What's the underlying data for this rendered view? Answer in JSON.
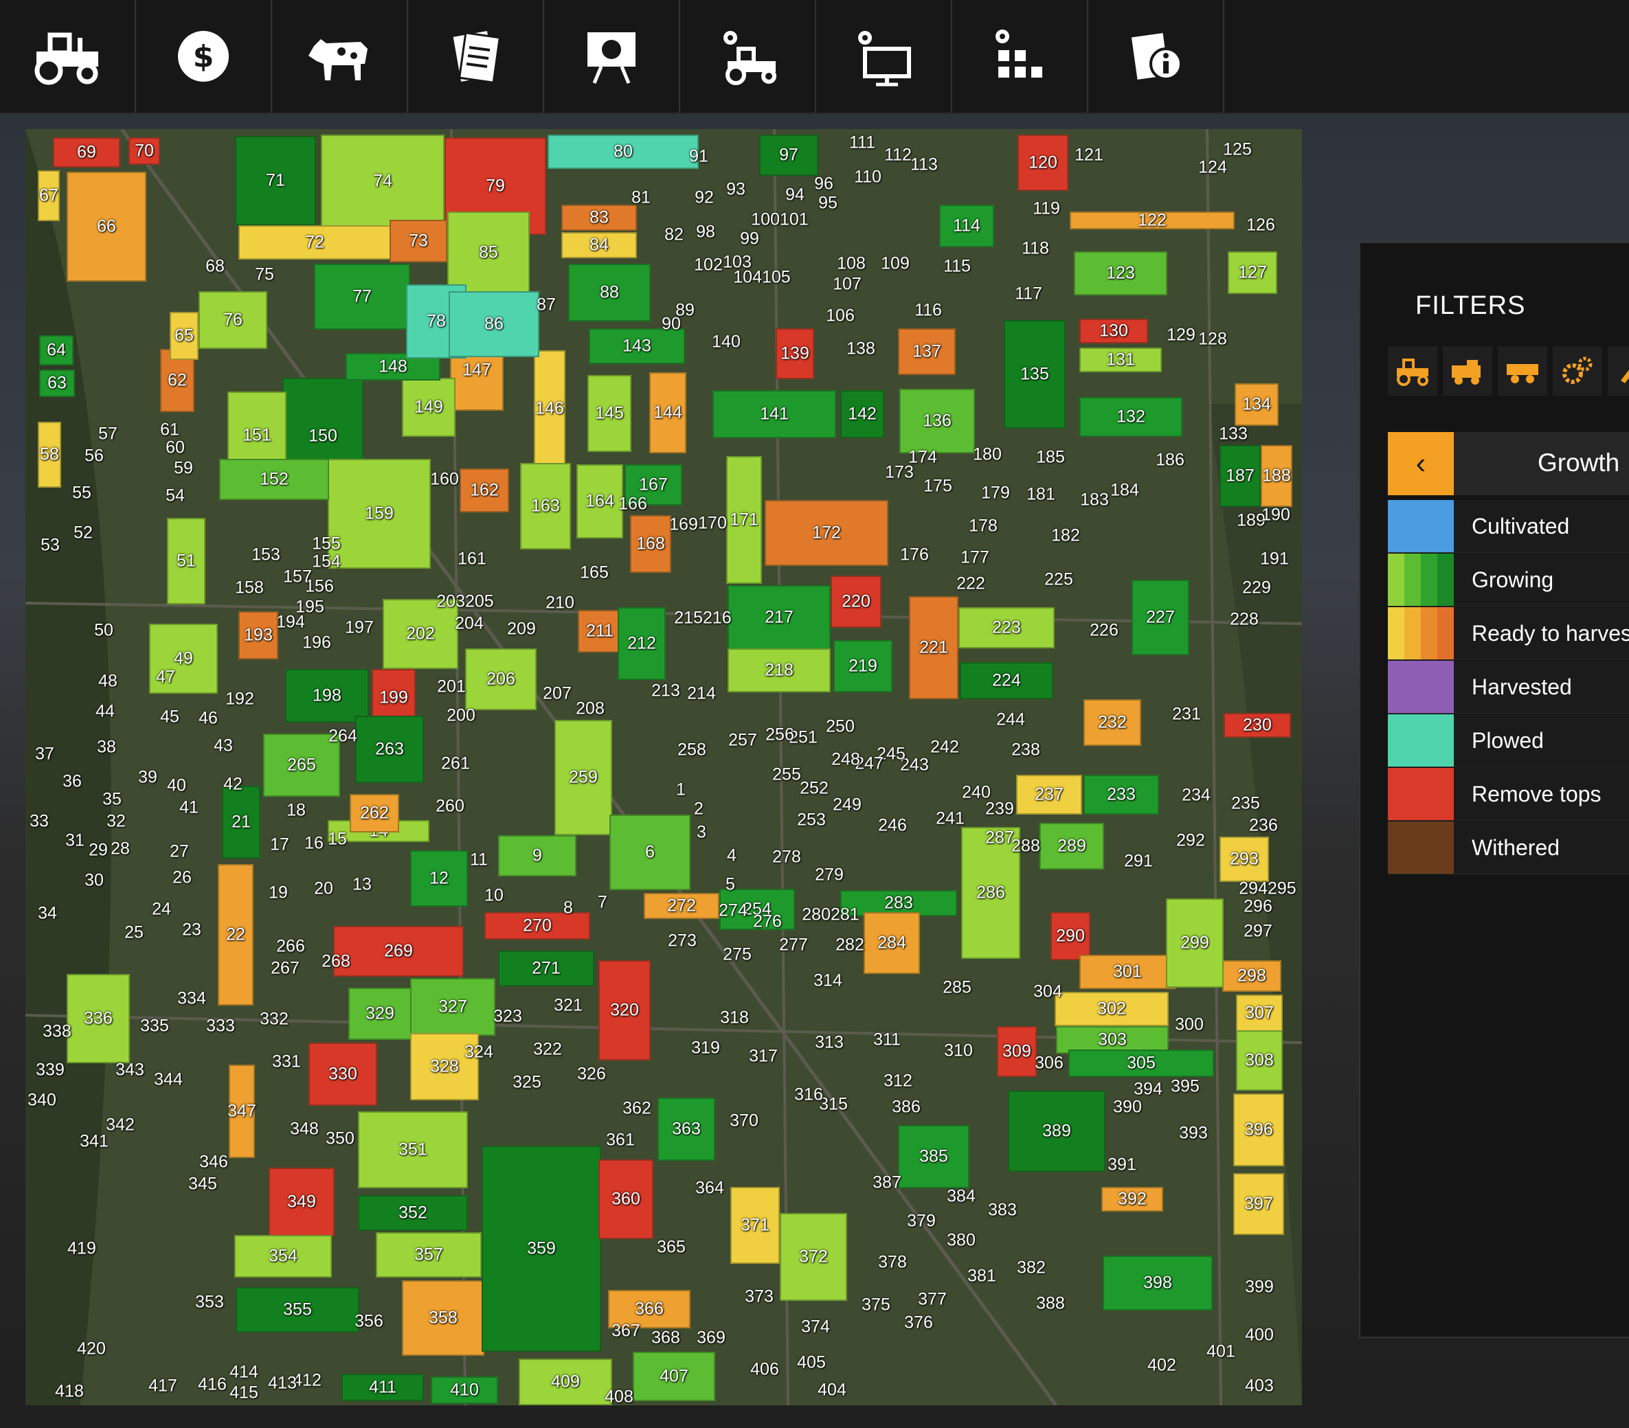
{
  "tabs": [
    {
      "icon": "tractor-icon"
    },
    {
      "icon": "dollar-icon"
    },
    {
      "icon": "cow-icon"
    },
    {
      "icon": "contracts-icon"
    },
    {
      "icon": "tutorial-board-icon"
    },
    {
      "icon": "vehicle-settings-icon"
    },
    {
      "icon": "display-settings-icon"
    },
    {
      "icon": "production-settings-icon"
    },
    {
      "icon": "help-info-icon"
    }
  ],
  "filters": {
    "title": "FILTERS",
    "filter_icons": [
      "tractor-icon",
      "harvester-icon",
      "trailer-icon",
      "gears-icon",
      "tool-icon"
    ],
    "category": "Growth",
    "legend": [
      {
        "label": "Cultivated",
        "colors": [
          "#4a9de0"
        ]
      },
      {
        "label": "Growing",
        "colors": [
          "#8fd23a",
          "#5cbd32",
          "#2fa32d",
          "#1a8a28"
        ]
      },
      {
        "label": "Ready to harves",
        "colors": [
          "#f0d040",
          "#f0b030",
          "#e98a2c",
          "#e0702a"
        ]
      },
      {
        "label": "Harvested",
        "colors": [
          "#8e5fb5"
        ]
      },
      {
        "label": "Plowed",
        "colors": [
          "#4fd4ae"
        ]
      },
      {
        "label": "Remove tops",
        "colors": [
          "#d93a2a"
        ]
      },
      {
        "label": "Withered",
        "colors": [
          "#6a3c1c"
        ]
      }
    ]
  },
  "colors": {
    "plowed": "#4fd4ae",
    "growing_1": "#9bd53a",
    "growing_2": "#5cbd32",
    "growing_3": "#1e9a2c",
    "growing_4": "#13801f",
    "ready_1": "#f0d040",
    "ready_2": "#eea030",
    "ready_3": "#e07a2a",
    "remove_tops": "#d83828"
  },
  "fields": [
    {
      "id": "69",
      "c": "remove_tops"
    },
    {
      "id": "70",
      "c": "remove_tops"
    },
    {
      "id": "66",
      "c": "ready_2"
    },
    {
      "id": "67",
      "c": "ready_1"
    },
    {
      "id": "71",
      "c": "growing_4"
    },
    {
      "id": "74",
      "c": "growing_1"
    },
    {
      "id": "79",
      "c": "remove_tops"
    },
    {
      "id": "80",
      "c": "plowed"
    },
    {
      "id": "72",
      "c": "ready_1"
    },
    {
      "id": "73",
      "c": "ready_3"
    },
    {
      "id": "85",
      "c": "growing_1"
    },
    {
      "id": "77",
      "c": "growing_3"
    },
    {
      "id": "76",
      "c": "growing_1"
    },
    {
      "id": "83",
      "c": "ready_3"
    },
    {
      "id": "84",
      "c": "ready_1"
    },
    {
      "id": "88",
      "c": "growing_3"
    },
    {
      "id": "97",
      "c": "growing_4"
    },
    {
      "id": "120",
      "c": "remove_tops"
    },
    {
      "id": "114",
      "c": "growing_3"
    },
    {
      "id": "122",
      "c": "ready_2"
    },
    {
      "id": "123",
      "c": "growing_2"
    },
    {
      "id": "127",
      "c": "growing_1"
    },
    {
      "id": "135",
      "c": "growing_4"
    },
    {
      "id": "130",
      "c": "remove_tops"
    },
    {
      "id": "131",
      "c": "growing_1"
    },
    {
      "id": "132",
      "c": "growing_3"
    },
    {
      "id": "134",
      "c": "ready_2"
    },
    {
      "id": "147",
      "c": "ready_2"
    },
    {
      "id": "146",
      "c": "ready_1"
    },
    {
      "id": "143",
      "c": "growing_3"
    },
    {
      "id": "144",
      "c": "ready_2"
    },
    {
      "id": "141",
      "c": "growing_3"
    },
    {
      "id": "142",
      "c": "growing_4"
    },
    {
      "id": "137",
      "c": "ready_3"
    },
    {
      "id": "139",
      "c": "remove_tops"
    },
    {
      "id": "150",
      "c": "growing_4"
    },
    {
      "id": "151",
      "c": "growing_1"
    },
    {
      "id": "159",
      "c": "growing_1"
    },
    {
      "id": "152",
      "c": "growing_2"
    },
    {
      "id": "172",
      "c": "ready_3"
    },
    {
      "id": "217",
      "c": "growing_3"
    },
    {
      "id": "220",
      "c": "remove_tops"
    },
    {
      "id": "221",
      "c": "ready_3"
    },
    {
      "id": "218",
      "c": "growing_1"
    },
    {
      "id": "219",
      "c": "growing_3"
    },
    {
      "id": "224",
      "c": "growing_4"
    },
    {
      "id": "223",
      "c": "growing_1"
    },
    {
      "id": "227",
      "c": "growing_3"
    },
    {
      "id": "202",
      "c": "growing_1"
    },
    {
      "id": "199",
      "c": "remove_tops"
    },
    {
      "id": "198",
      "c": "growing_4"
    },
    {
      "id": "265",
      "c": "growing_2"
    },
    {
      "id": "263",
      "c": "growing_4"
    },
    {
      "id": "259",
      "c": "growing_1"
    },
    {
      "id": "6",
      "c": "growing_2"
    },
    {
      "id": "9",
      "c": "growing_2"
    },
    {
      "id": "269",
      "c": "remove_tops"
    },
    {
      "id": "270",
      "c": "remove_tops"
    },
    {
      "id": "271",
      "c": "growing_4"
    },
    {
      "id": "320",
      "c": "remove_tops"
    },
    {
      "id": "272",
      "c": "ready_2"
    },
    {
      "id": "283",
      "c": "growing_3"
    },
    {
      "id": "284",
      "c": "ready_2"
    },
    {
      "id": "286",
      "c": "growing_1"
    },
    {
      "id": "290",
      "c": "remove_tops"
    },
    {
      "id": "301",
      "c": "ready_2"
    },
    {
      "id": "302",
      "c": "ready_1"
    },
    {
      "id": "303",
      "c": "growing_2"
    },
    {
      "id": "305",
      "c": "growing_3"
    },
    {
      "id": "309",
      "c": "remove_tops"
    },
    {
      "id": "329",
      "c": "growing_2"
    },
    {
      "id": "327",
      "c": "growing_2"
    },
    {
      "id": "330",
      "c": "remove_tops"
    },
    {
      "id": "328",
      "c": "ready_1"
    },
    {
      "id": "349",
      "c": "remove_tops"
    },
    {
      "id": "351",
      "c": "growing_1"
    },
    {
      "id": "352",
      "c": "growing_4"
    },
    {
      "id": "354",
      "c": "growing_1"
    },
    {
      "id": "357",
      "c": "growing_1"
    },
    {
      "id": "355",
      "c": "growing_4"
    },
    {
      "id": "358",
      "c": "ready_2"
    },
    {
      "id": "359",
      "c": "growing_4"
    },
    {
      "id": "360",
      "c": "remove_tops"
    },
    {
      "id": "366",
      "c": "ready_2"
    },
    {
      "id": "363",
      "c": "growing_3"
    },
    {
      "id": "371",
      "c": "ready_1"
    },
    {
      "id": "372",
      "c": "growing_1"
    },
    {
      "id": "385",
      "c": "growing_3"
    },
    {
      "id": "389",
      "c": "growing_4"
    },
    {
      "id": "398",
      "c": "growing_3"
    },
    {
      "id": "396",
      "c": "ready_1"
    },
    {
      "id": "397",
      "c": "ready_1"
    },
    {
      "id": "392",
      "c": "ready_2"
    },
    {
      "id": "336",
      "c": "growing_1"
    },
    {
      "id": "22",
      "c": "ready_2"
    },
    {
      "id": "347",
      "c": "ready_2"
    },
    {
      "id": "409",
      "c": "growing_1"
    },
    {
      "id": "407",
      "c": "growing_2"
    },
    {
      "id": "410",
      "c": "growing_3"
    },
    {
      "id": "411",
      "c": "growing_4"
    },
    {
      "id": "254",
      "c": "growing_3"
    },
    {
      "id": "289",
      "c": "growing_2"
    },
    {
      "id": "237",
      "c": "ready_1"
    },
    {
      "id": "233",
      "c": "growing_3"
    },
    {
      "id": "232",
      "c": "ready_2"
    },
    {
      "id": "187",
      "c": "growing_4"
    },
    {
      "id": "188",
      "c": "ready_2"
    },
    {
      "id": "230",
      "c": "remove_tops"
    },
    {
      "id": "293",
      "c": "ready_1"
    },
    {
      "id": "298",
      "c": "ready_2"
    },
    {
      "id": "307",
      "c": "ready_1"
    },
    {
      "id": "308",
      "c": "growing_1"
    },
    {
      "id": "299",
      "c": "growing_1"
    },
    {
      "id": "21",
      "c": "growing_4"
    },
    {
      "id": "12",
      "c": "growing_3"
    },
    {
      "id": "14",
      "c": "growing_1"
    },
    {
      "id": "262",
      "c": "ready_2"
    },
    {
      "id": "193",
      "c": "ready_3"
    },
    {
      "id": "211",
      "c": "ready_3"
    },
    {
      "id": "212",
      "c": "growing_3"
    },
    {
      "id": "206",
      "c": "growing_1"
    },
    {
      "id": "167",
      "c": "growing_3"
    },
    {
      "id": "162",
      "c": "ready_3"
    },
    {
      "id": "163",
      "c": "growing_1"
    },
    {
      "id": "164",
      "c": "growing_1"
    },
    {
      "id": "171",
      "c": "growing_1"
    },
    {
      "id": "168",
      "c": "ready_3"
    },
    {
      "id": "136",
      "c": "growing_2"
    },
    {
      "id": "149",
      "c": "growing_1"
    },
    {
      "id": "148",
      "c": "growing_3"
    },
    {
      "id": "145",
      "c": "growing_1"
    },
    {
      "id": "49",
      "c": "growing_1"
    },
    {
      "id": "51",
      "c": "growing_1"
    },
    {
      "id": "58",
      "c": "ready_1"
    },
    {
      "id": "63",
      "c": "growing_3"
    },
    {
      "id": "64",
      "c": "growing_3"
    },
    {
      "id": "62",
      "c": "ready_3"
    },
    {
      "id": "65",
      "c": "ready_1"
    },
    {
      "id": "78",
      "c": "plowed"
    },
    {
      "id": "86",
      "c": "plowed"
    }
  ]
}
